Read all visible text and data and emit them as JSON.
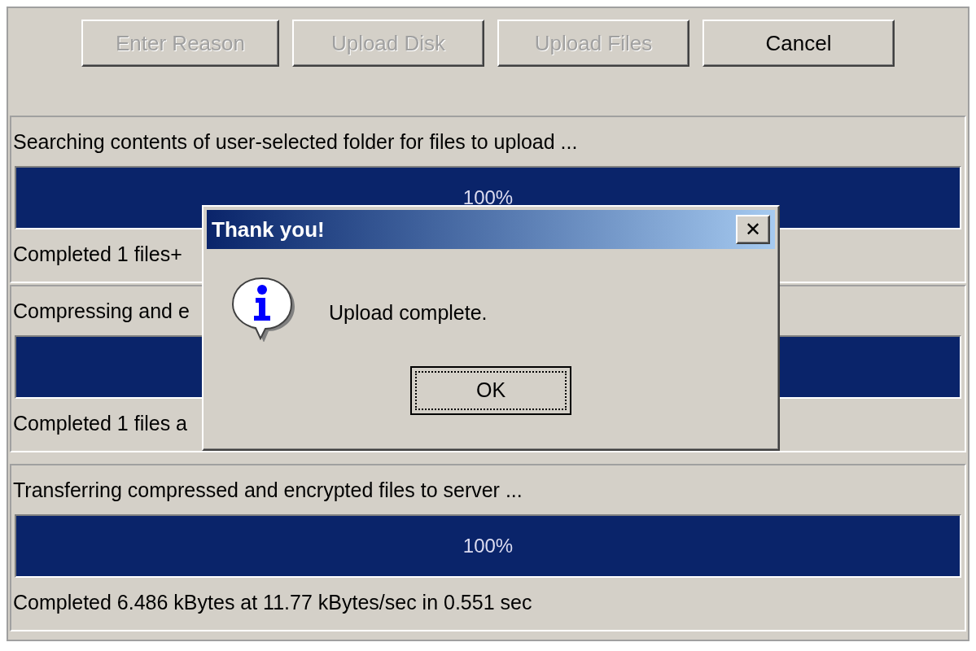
{
  "toolbar": {
    "buttons": [
      {
        "label": "Enter Reason",
        "disabled": true
      },
      {
        "label": "Upload Disk",
        "disabled": true
      },
      {
        "label": "Upload Files",
        "disabled": true
      },
      {
        "label": "Cancel",
        "disabled": false
      }
    ]
  },
  "stages": [
    {
      "title": "Searching contents of user-selected folder for files to upload ...",
      "progress": {
        "level": 1,
        "label": "100%"
      },
      "status": "Completed 1 files+"
    },
    {
      "title": "Compressing and e",
      "progress": {
        "level": 1
      },
      "status": "Completed 1 files a"
    },
    {
      "title": "Transferring compressed and encrypted files to server ...",
      "progress": {
        "level": 1,
        "label": "100%"
      },
      "status": "Completed 6.486 kBytes at 11.77 kBytes/sec in 0.551 sec"
    }
  ],
  "dialog": {
    "title": "Thank you!",
    "close": "✕",
    "message": "Upload complete.",
    "buttons": [
      {
        "label": "OK",
        "focused": true
      }
    ]
  }
}
